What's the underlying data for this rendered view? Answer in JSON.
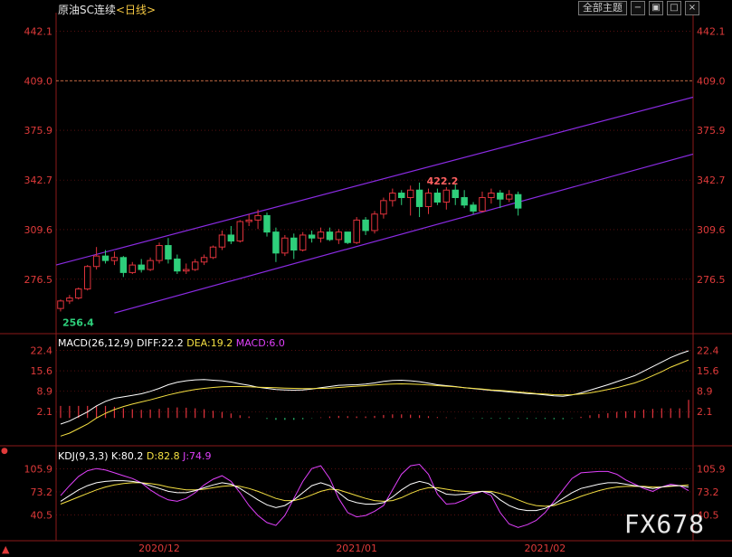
{
  "header": {
    "instrument": "原油SC连续",
    "period": "<日线>",
    "theme_button": "全部主题",
    "icons": [
      "minus-box-icon",
      "image-icon",
      "maximize-icon",
      "close-icon"
    ]
  },
  "colors": {
    "up": "#e0333c",
    "down": "#2ecf7b",
    "channel": "#8a2be2",
    "grid": "#8b1a1a",
    "price_line": "#ff8c5a",
    "diff": "#ffffff",
    "dea": "#f5e042",
    "macd": "#e040fb",
    "k": "#ffffff",
    "d": "#f5e042",
    "j": "#e040fb"
  },
  "chart_data": [
    {
      "type": "candlestick",
      "name": "main",
      "y_ticks": [
        442.1,
        409.0,
        375.9,
        342.7,
        309.6,
        276.5
      ],
      "y_tick_labels": [
        "442.1",
        "409.0",
        "375.9",
        "342.7",
        "309.6",
        "276.5"
      ],
      "ylim": [
        242,
        452
      ],
      "current_price": 409.0,
      "annotations": [
        {
          "label": "422.2",
          "kind": "high"
        },
        {
          "label": "256.4",
          "kind": "low"
        }
      ],
      "x_labels": [
        {
          "label": "2020/12",
          "index": 11
        },
        {
          "label": "2021/01",
          "index": 33
        },
        {
          "label": "2021/02",
          "index": 54
        }
      ],
      "channel": {
        "upper": [
          [
            -0.5,
            286.0
          ],
          [
            70.5,
            398.0
          ]
        ],
        "lower": [
          [
            6.0,
            254.0
          ],
          [
            70.5,
            360.0
          ]
        ]
      },
      "candles": [
        [
          257,
          263,
          255,
          262
        ],
        [
          262,
          266,
          260,
          264
        ],
        [
          264,
          271,
          263,
          270
        ],
        [
          270,
          286,
          269,
          285
        ],
        [
          285,
          298,
          283,
          292
        ],
        [
          292,
          296,
          287,
          289
        ],
        [
          289,
          295,
          286,
          291
        ],
        [
          291,
          292,
          278,
          281
        ],
        [
          281,
          288,
          280,
          286
        ],
        [
          286,
          290,
          281,
          283
        ],
        [
          283,
          291,
          282,
          289
        ],
        [
          289,
          301,
          287,
          299
        ],
        [
          299,
          304,
          287,
          290
        ],
        [
          290,
          293,
          280,
          282
        ],
        [
          282,
          287,
          280,
          283
        ],
        [
          283,
          290,
          282,
          288
        ],
        [
          288,
          293,
          286,
          291
        ],
        [
          291,
          299,
          290,
          298
        ],
        [
          298,
          309,
          296,
          306
        ],
        [
          306,
          312,
          300,
          302
        ],
        [
          302,
          316,
          301,
          315
        ],
        [
          315,
          320,
          312,
          316
        ],
        [
          316,
          323,
          310,
          319
        ],
        [
          319,
          321,
          305,
          308
        ],
        [
          308,
          311,
          288,
          294
        ],
        [
          294,
          306,
          292,
          304
        ],
        [
          304,
          307,
          290,
          296
        ],
        [
          296,
          308,
          295,
          306
        ],
        [
          306,
          309,
          301,
          304
        ],
        [
          304,
          311,
          301,
          308
        ],
        [
          308,
          311,
          302,
          303
        ],
        [
          303,
          310,
          300,
          308
        ],
        [
          308,
          307,
          300,
          301
        ],
        [
          301,
          318,
          300,
          316
        ],
        [
          316,
          318,
          306,
          309
        ],
        [
          309,
          322,
          307,
          320
        ],
        [
          320,
          331,
          317,
          329
        ],
        [
          329,
          337,
          325,
          334
        ],
        [
          334,
          336,
          326,
          331
        ],
        [
          331,
          339,
          319,
          336
        ],
        [
          336,
          341,
          318,
          325
        ],
        [
          325,
          337,
          320,
          334
        ],
        [
          334,
          337,
          326,
          328
        ],
        [
          328,
          338,
          323,
          336
        ],
        [
          336,
          340,
          326,
          331
        ],
        [
          331,
          336,
          324,
          326
        ],
        [
          326,
          328,
          320,
          322
        ],
        [
          322,
          335,
          321,
          331
        ],
        [
          331,
          337,
          327,
          334
        ],
        [
          334,
          336,
          324,
          330
        ],
        [
          330,
          336,
          328,
          333
        ],
        [
          333,
          335,
          319,
          324
        ]
      ]
    },
    {
      "type": "line",
      "name": "MACD",
      "label_prefix": "MACD(26,12,9)",
      "series": [
        {
          "name": "DIFF",
          "label": "DIFF:22.2",
          "values": [
            -2.0,
            -1.0,
            0.5,
            2.0,
            4.0,
            5.5,
            6.5,
            7.0,
            7.5,
            8.0,
            8.8,
            9.8,
            11.0,
            11.8,
            12.3,
            12.6,
            12.7,
            12.5,
            12.3,
            11.9,
            11.3,
            10.8,
            10.2,
            9.8,
            9.4,
            9.3,
            9.2,
            9.3,
            9.6,
            10.0,
            10.4,
            10.8,
            10.9,
            11.0,
            11.2,
            11.6,
            12.1,
            12.4,
            12.5,
            12.3,
            12.0,
            11.5,
            11.0,
            10.7,
            10.4,
            10.0,
            9.7,
            9.4,
            9.1,
            8.9,
            8.6,
            8.4,
            8.1,
            7.9,
            7.6,
            7.3,
            7.2,
            7.6,
            8.3,
            9.2,
            10.1,
            11.0,
            12.0,
            13.0,
            14.0,
            15.5,
            17.0,
            18.5,
            20.0,
            21.2,
            22.2
          ]
        },
        {
          "name": "DEA",
          "label": "DEA:19.2",
          "values": [
            -6.0,
            -5.0,
            -3.5,
            -2.0,
            0.0,
            1.5,
            2.8,
            3.8,
            4.6,
            5.3,
            6.0,
            6.8,
            7.6,
            8.3,
            8.9,
            9.4,
            9.8,
            10.1,
            10.3,
            10.4,
            10.4,
            10.3,
            10.2,
            10.1,
            10.0,
            9.9,
            9.8,
            9.7,
            9.7,
            9.8,
            9.9,
            10.1,
            10.3,
            10.5,
            10.7,
            10.9,
            11.1,
            11.2,
            11.3,
            11.2,
            11.1,
            10.9,
            10.7,
            10.5,
            10.3,
            10.0,
            9.8,
            9.6,
            9.3,
            9.1,
            8.9,
            8.6,
            8.4,
            8.1,
            7.9,
            7.7,
            7.6,
            7.7,
            7.9,
            8.3,
            8.8,
            9.4,
            10.0,
            10.8,
            11.6,
            12.7,
            14.0,
            15.3,
            16.8,
            18.0,
            19.2
          ]
        },
        {
          "name": "MACD",
          "label": "MACD:6.0",
          "values": [
            4.0,
            4.0,
            4.0,
            4.0,
            4.0,
            4.0,
            3.7,
            3.2,
            2.9,
            2.7,
            2.8,
            3.0,
            3.4,
            3.5,
            3.4,
            3.2,
            2.9,
            2.4,
            2.0,
            1.5,
            0.9,
            0.5,
            0.0,
            -0.3,
            -0.6,
            -0.6,
            -0.6,
            -0.4,
            -0.1,
            0.2,
            0.5,
            0.7,
            0.6,
            0.5,
            0.5,
            0.7,
            1.0,
            1.2,
            1.2,
            1.1,
            0.9,
            0.6,
            0.3,
            0.2,
            0.1,
            0.0,
            -0.1,
            -0.2,
            -0.2,
            -0.2,
            -0.3,
            -0.2,
            -0.3,
            -0.2,
            -0.3,
            -0.4,
            -0.4,
            -0.1,
            0.4,
            0.9,
            1.3,
            1.6,
            2.0,
            2.2,
            2.4,
            2.8,
            3.0,
            3.2,
            3.2,
            3.2,
            6.0
          ]
        }
      ],
      "y_ticks": [
        22.4,
        15.6,
        8.9,
        2.1
      ],
      "y_tick_labels": [
        "22.4",
        "15.6",
        "8.9",
        "2.1"
      ],
      "ylim": [
        -6.5,
        24.0
      ]
    },
    {
      "type": "line",
      "name": "KDJ",
      "label_prefix": "KDJ(9,3,3)",
      "series": [
        {
          "name": "K",
          "label": "K:80.2",
          "values": [
            60,
            68,
            76,
            82,
            86,
            88,
            89,
            89,
            88,
            86,
            82,
            78,
            74,
            72,
            72,
            75,
            79,
            83,
            86,
            84,
            78,
            70,
            62,
            55,
            51,
            54,
            62,
            72,
            82,
            86,
            82,
            72,
            62,
            58,
            56,
            56,
            58,
            66,
            76,
            84,
            88,
            85,
            76,
            70,
            69,
            70,
            72,
            74,
            72,
            62,
            54,
            49,
            47,
            47,
            50,
            56,
            64,
            72,
            78,
            81,
            84,
            86,
            86,
            84,
            82,
            80,
            78,
            80,
            82,
            82,
            80
          ]
        },
        {
          "name": "D",
          "label": "D:82.8",
          "values": [
            56,
            61,
            66,
            71,
            76,
            80,
            83,
            85,
            86,
            86,
            85,
            83,
            80,
            78,
            76,
            76,
            77,
            79,
            81,
            82,
            81,
            78,
            74,
            69,
            64,
            61,
            61,
            64,
            69,
            74,
            77,
            76,
            72,
            68,
            64,
            61,
            60,
            61,
            65,
            71,
            76,
            79,
            79,
            77,
            75,
            74,
            73,
            74,
            74,
            71,
            67,
            62,
            57,
            54,
            53,
            54,
            58,
            62,
            67,
            71,
            75,
            78,
            80,
            81,
            81,
            81,
            80,
            80,
            81,
            82,
            82.8
          ]
        },
        {
          "name": "J",
          "label": "J:74.9",
          "values": [
            68,
            82,
            95,
            103,
            106,
            104,
            100,
            96,
            92,
            86,
            76,
            68,
            62,
            60,
            64,
            72,
            83,
            91,
            96,
            88,
            72,
            54,
            40,
            30,
            26,
            40,
            64,
            88,
            106,
            110,
            92,
            64,
            44,
            38,
            40,
            46,
            54,
            76,
            98,
            110,
            112,
            98,
            70,
            56,
            57,
            62,
            70,
            74,
            68,
            44,
            28,
            23,
            27,
            33,
            44,
            60,
            76,
            92,
            100,
            101,
            102,
            102,
            98,
            90,
            84,
            78,
            74,
            80,
            84,
            82,
            74.9
          ]
        }
      ],
      "y_ticks": [
        105.9,
        73.2,
        40.5
      ],
      "y_tick_labels": [
        "105.9",
        "73.2",
        "40.5"
      ],
      "ylim": [
        7,
        119
      ]
    }
  ],
  "watermark": "FX678"
}
